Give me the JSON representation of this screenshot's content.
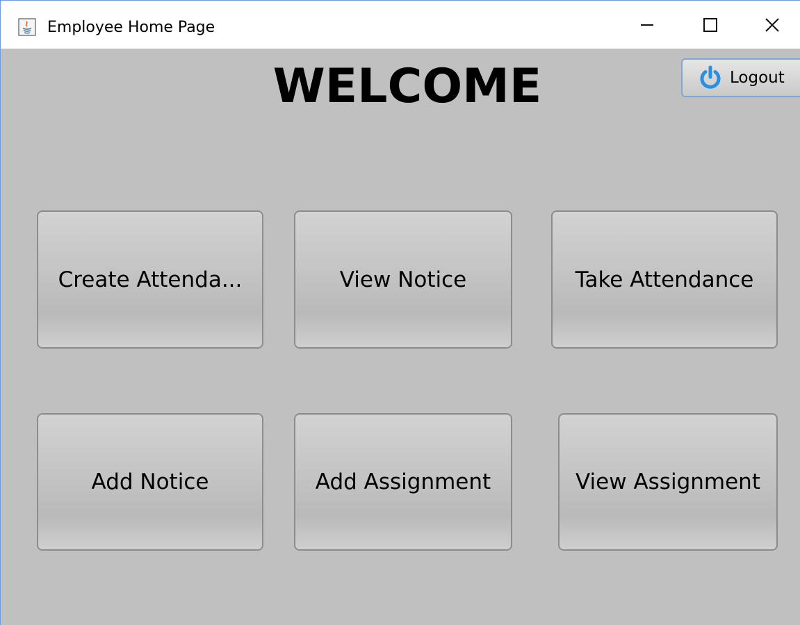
{
  "window": {
    "title": "Employee Home Page",
    "app_icon": "java-icon",
    "controls": {
      "minimize_icon": "minimize-icon",
      "maximize_icon": "maximize-icon",
      "close_icon": "close-icon"
    }
  },
  "main": {
    "heading": "WELCOME",
    "logout": {
      "label": "Logout",
      "icon": "power-icon",
      "icon_color": "#2a8fe0"
    },
    "tiles": [
      {
        "label": "Create Attenda..."
      },
      {
        "label": "View Notice"
      },
      {
        "label": "Take Attendance"
      },
      {
        "label": "Add Notice"
      },
      {
        "label": "Add Assignment"
      },
      {
        "label": "View Assignment"
      }
    ]
  },
  "colors": {
    "background": "#c0c0c0",
    "window_border": "#6f9bd6",
    "logout_border": "#7fa7d3"
  }
}
